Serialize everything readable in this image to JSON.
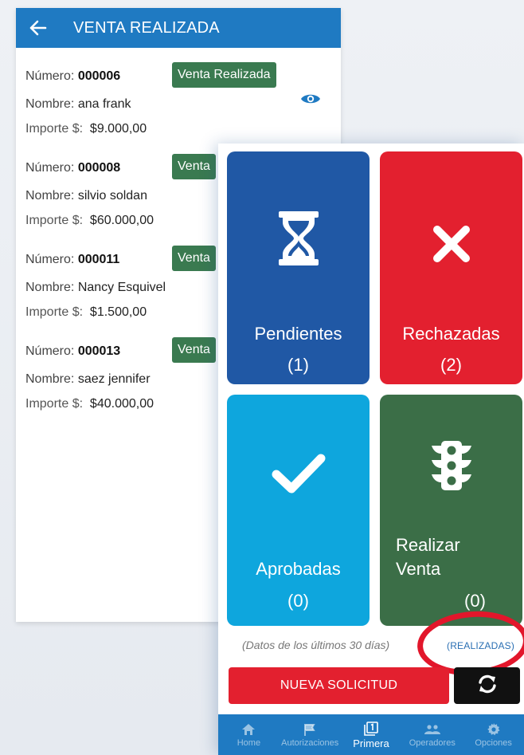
{
  "list_screen": {
    "title": "VENTA REALIZADA",
    "labels": {
      "numero": "Número:",
      "nombre": "Nombre:",
      "importe": "Importe $:"
    },
    "sales": [
      {
        "numero": "000006",
        "nombre": "ana frank",
        "importe": "$9.000,00",
        "status": "Venta Realizada"
      },
      {
        "numero": "000008",
        "nombre": "silvio soldan",
        "importe": "$60.000,00",
        "status": "Venta"
      },
      {
        "numero": "000011",
        "nombre": "Nancy Esquivel",
        "importe": "$1.500,00",
        "status": "Venta"
      },
      {
        "numero": "000013",
        "nombre": "saez jennifer",
        "importe": "$40.000,00",
        "status": "Venta"
      }
    ]
  },
  "dashboard": {
    "tiles": {
      "pendientes": {
        "label": "Pendientes",
        "count": "(1)",
        "color": "#2058a5",
        "icon": "hourglass-icon"
      },
      "rechazadas": {
        "label": "Rechazadas",
        "count": "(2)",
        "color": "#e3202f",
        "icon": "close-icon"
      },
      "aprobadas": {
        "label": "Aprobadas",
        "count": "(0)",
        "color": "#0ea6dd",
        "icon": "check-icon"
      },
      "realizar": {
        "label_line1": "Realizar",
        "label_line2": "Venta",
        "count": "(0)",
        "color": "#3b6e47",
        "icon": "traffic-light-icon"
      }
    },
    "footnote": "(Datos de los últimos 30 días)",
    "realizadas_link": "(REALIZADAS)",
    "new_request_button": "NUEVA SOLICITUD",
    "refresh_icon": "refresh-icon"
  },
  "bottom_nav": {
    "items": [
      {
        "label": "Home",
        "icon": "home-icon"
      },
      {
        "label": "Autorizaciones",
        "icon": "flag-icon"
      },
      {
        "label": "Primera",
        "icon": "number-one-icon",
        "active": true
      },
      {
        "label": "Operadores",
        "icon": "people-icon"
      },
      {
        "label": "Opciones",
        "icon": "gear-icon"
      }
    ]
  },
  "colors": {
    "primary": "#1f7ac2",
    "badge_green": "#3a7a50",
    "highlight_ring": "#e2162b"
  }
}
